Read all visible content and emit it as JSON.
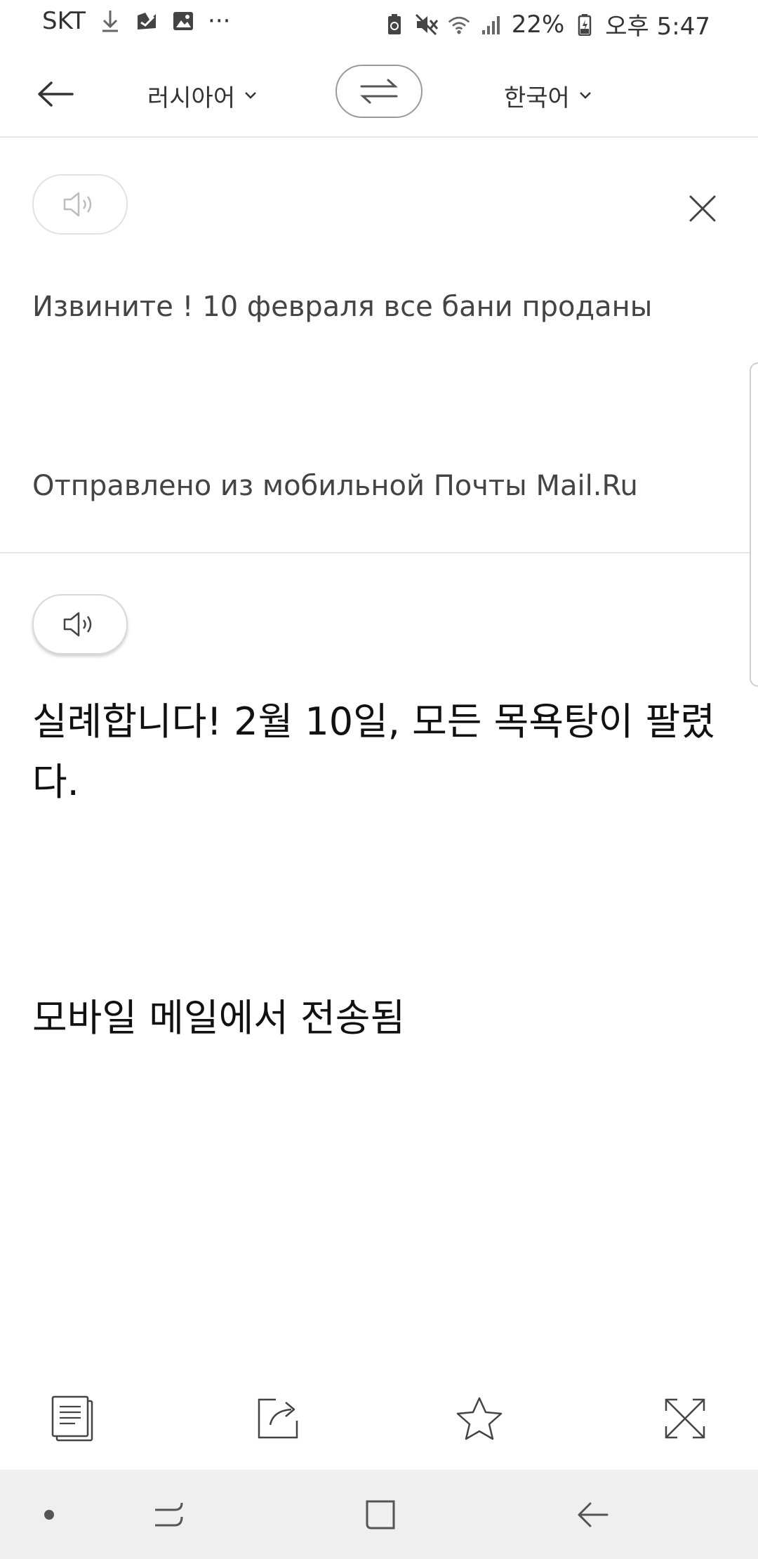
{
  "status_bar": {
    "carrier": "SKT",
    "battery_percent": "22%",
    "time": "오후 5:47",
    "more": "···",
    "icons": [
      "download-icon",
      "maps-icon",
      "image-icon",
      "battery-saver-icon",
      "mute-icon",
      "wifi-icon",
      "signal-icon",
      "battery-icon"
    ]
  },
  "header": {
    "source_language": "러시아어",
    "target_language": "한국어"
  },
  "source": {
    "text_line1": "Извините ! 10 февраля все бани проданы",
    "text_line2": "Отправлено из мобильной Почты Mail.Ru"
  },
  "translation": {
    "text_line1": "실례합니다! 2월 10일, 모든 목욕탕이 팔렸다.",
    "text_line2": "모바일 메일에서 전송됨"
  },
  "toolbar": {
    "icons": [
      "copy-icon",
      "share-icon",
      "star-icon",
      "fullscreen-icon"
    ]
  },
  "colors": {
    "background": "#ffffff",
    "divider": "#e6e6e6",
    "navbar": "#efefef",
    "text_primary": "#111111",
    "text_secondary": "#444444"
  }
}
